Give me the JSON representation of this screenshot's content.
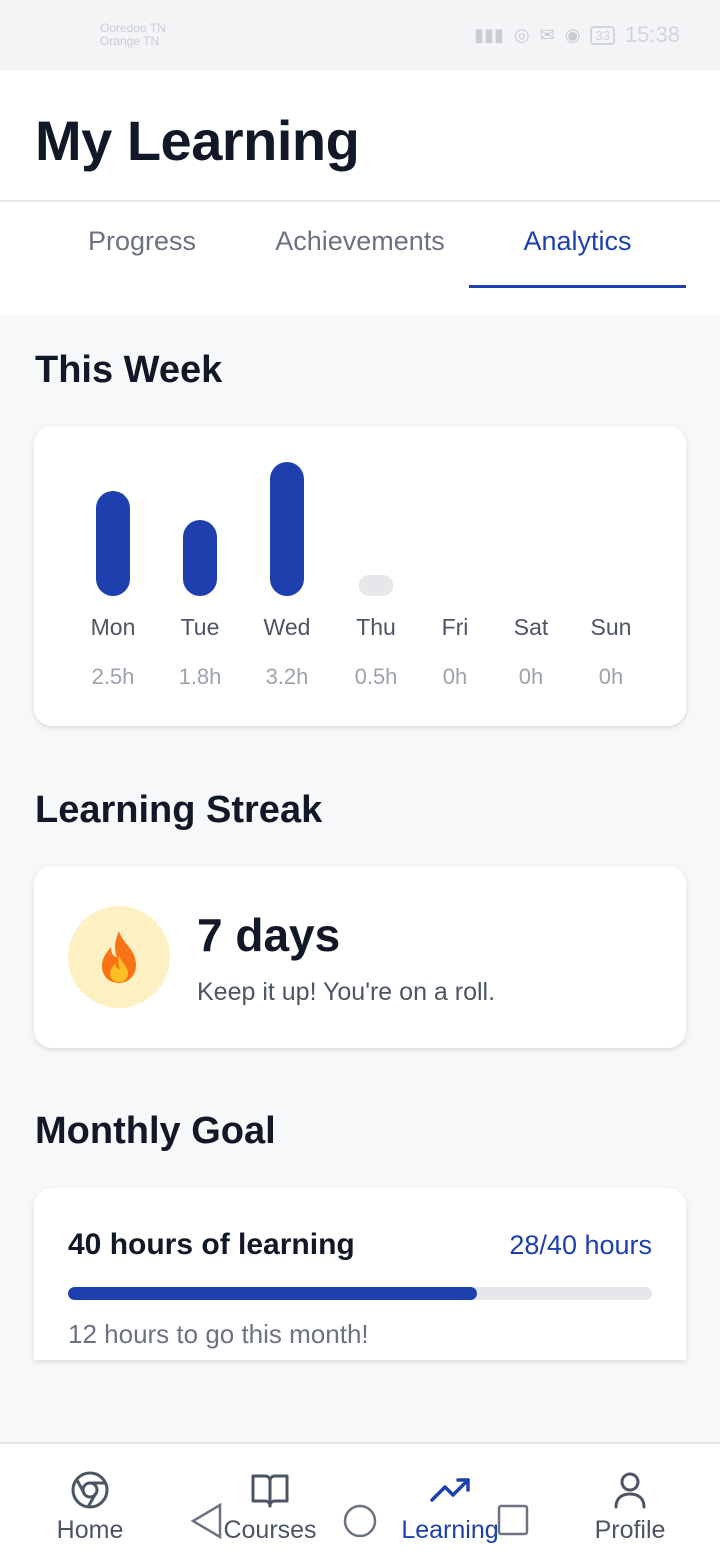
{
  "status_bar": {
    "carrier_line1": "Ooredoo TN",
    "carrier_line2": "Orange TN",
    "battery": "33",
    "time": "15:38"
  },
  "header": {
    "title": "My Learning"
  },
  "tabs": [
    {
      "label": "Progress",
      "active": false
    },
    {
      "label": "Achievements",
      "active": false
    },
    {
      "label": "Analytics",
      "active": true
    }
  ],
  "this_week": {
    "title": "This Week",
    "days": [
      {
        "day": "Mon",
        "hours_label": "2.5h",
        "hours": 2.5
      },
      {
        "day": "Tue",
        "hours_label": "1.8h",
        "hours": 1.8
      },
      {
        "day": "Wed",
        "hours_label": "3.2h",
        "hours": 3.2
      },
      {
        "day": "Thu",
        "hours_label": "0.5h",
        "hours": 0.5
      },
      {
        "day": "Fri",
        "hours_label": "0h",
        "hours": 0
      },
      {
        "day": "Sat",
        "hours_label": "0h",
        "hours": 0
      },
      {
        "day": "Sun",
        "hours_label": "0h",
        "hours": 0
      }
    ]
  },
  "streak": {
    "title": "Learning Streak",
    "value": "7 days",
    "message": "Keep it up! You're on a roll."
  },
  "monthly_goal": {
    "title": "Monthly Goal",
    "goal_label": "40 hours of learning",
    "count_label": "28/40 hours",
    "progress_fraction": 0.7,
    "remaining_text": "12 hours to go this month!"
  },
  "bottom_nav": [
    {
      "label": "Home",
      "icon": "chrome-icon",
      "active": false
    },
    {
      "label": "Courses",
      "icon": "book-icon",
      "active": false
    },
    {
      "label": "Learning",
      "icon": "trending-up-icon",
      "active": true
    },
    {
      "label": "Profile",
      "icon": "user-icon",
      "active": false
    }
  ],
  "colors": {
    "accent": "#1e40af",
    "track": "#e5e7eb",
    "flame_bg": "#fdf1c4"
  }
}
